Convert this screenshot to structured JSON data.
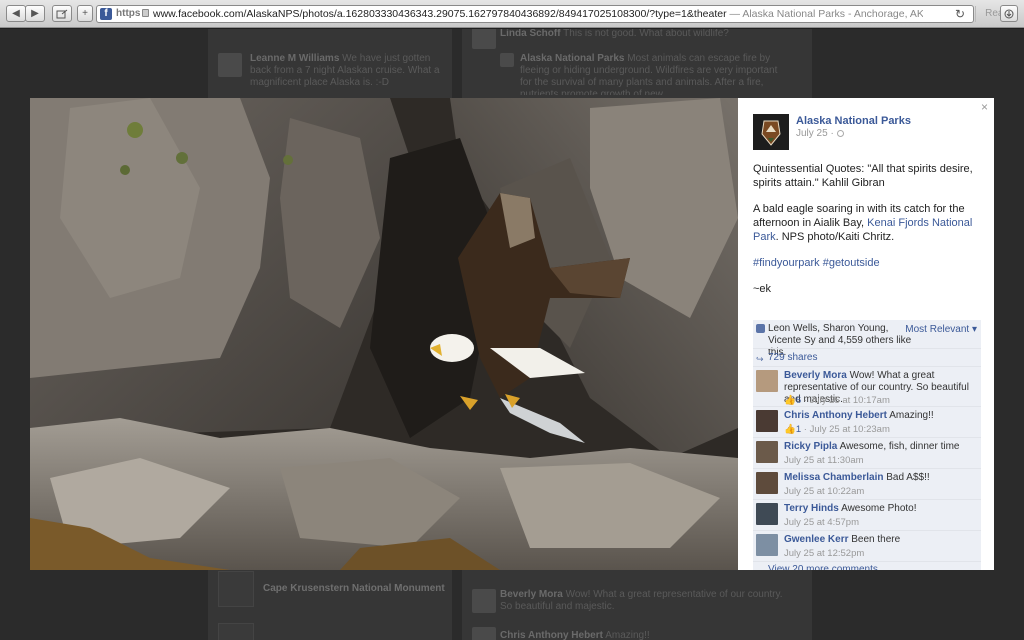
{
  "browser": {
    "url_scheme": "https",
    "url": "www.facebook.com/AlaskaNPS/photos/a.162803330436343.29075.162797840436892/849417025108300/?type=1&theater",
    "page_title": " — Alaska National Parks - Anchorage, AK - Government Organi...",
    "reader_label": "Reader",
    "back_glyph": "◀",
    "forward_glyph": "▶",
    "add_glyph": "+",
    "reload_glyph": "↻"
  },
  "background": {
    "top_comment_name": "Linda Schoff",
    "top_comment_text": "This is not good. What about wildlife?",
    "left_commenter": "Leanne M Williams",
    "left_comment_text": "We have just gotten back from a 7 night Alaskan cruise. What a magnificent place Alaska is. :-D",
    "reply_name": "Alaska National Parks",
    "reply_text": "Most animals can escape fire by fleeing or hiding underground. Wildfires are very important for the survival of many plants and animals. After a fire, nutrients promote growth of new",
    "monument": "Cape Krusenstern National Monument",
    "bottom_c1_name": "Beverly Mora",
    "bottom_c1_text": "Wow! What a great representative of our country. So beautiful and majestic.",
    "bottom_c2_name": "Chris Anthony Hebert",
    "bottom_c2_text": "Amazing!!"
  },
  "post": {
    "page_name": "Alaska National Parks",
    "date": "July 25 ·",
    "quote": "Quintessential Quotes: \"All that spirits desire, spirits attain.\" Kahlil Gibran",
    "caption_before": "A bald eagle soaring in with its catch for the afternoon in Aialik Bay, ",
    "caption_link": "Kenai Fjords National Park",
    "caption_after": ". NPS photo/Kaiti Chritz.",
    "hashtags": "#findyourpark #getoutside",
    "signature": "~ek",
    "close_glyph": "×"
  },
  "ufi": {
    "likes_text": "Leon Wells, Sharon Young, Vicente Sy and 4,559 others like this.",
    "most_relevant": "Most Relevant ▾",
    "shares": "729 shares",
    "view_more": "View 20 more comments"
  },
  "comments": [
    {
      "name": "Beverly Mora",
      "text": "Wow! What a great representative of our country. So beautiful and majestic.",
      "likes": "6",
      "time": "July 25 at 10:17am"
    },
    {
      "name": "Chris Anthony Hebert",
      "text": "Amazing!!",
      "likes": "1",
      "time": "July 25 at 10:23am"
    },
    {
      "name": "Ricky Pipla",
      "text": "Awesome, fish, dinner time",
      "likes": "",
      "time": "July 25 at 11:30am"
    },
    {
      "name": "Melissa Chamberlain",
      "text": "Bad A$$!!",
      "likes": "",
      "time": "July 25 at 10:22am"
    },
    {
      "name": "Terry Hinds",
      "text": "Awesome Photo!",
      "likes": "",
      "time": "July 25 at 4:57pm"
    },
    {
      "name": "Gwenlee Kerr",
      "text": "Been there",
      "likes": "",
      "time": "July 25 at 12:52pm"
    }
  ],
  "colors": {
    "facebook_blue": "#3b5998",
    "ufi_background": "#eceff5"
  }
}
